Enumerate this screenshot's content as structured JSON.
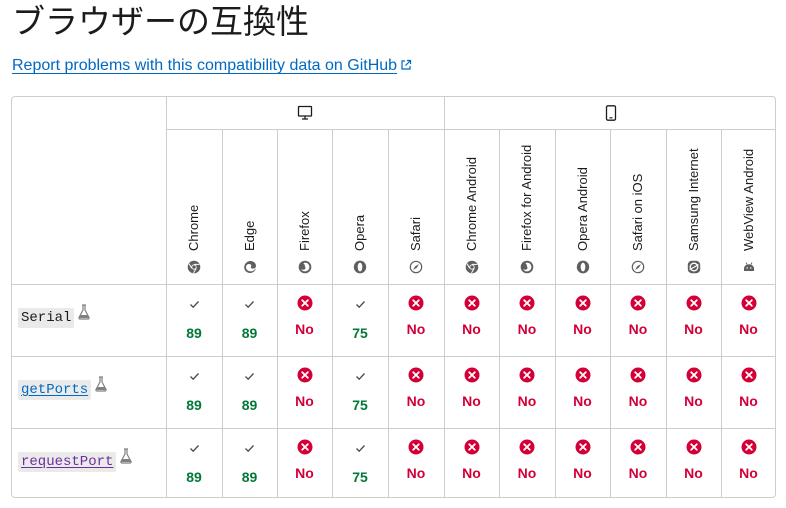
{
  "heading": "ブラウザーの互換性",
  "report_link": "Report problems with this compatibility data on GitHub",
  "groups": [
    {
      "name": "desktop",
      "icon": "desktop-icon"
    },
    {
      "name": "mobile",
      "icon": "mobile-icon"
    }
  ],
  "browsers": [
    {
      "name": "Chrome",
      "icon": "chrome-icon"
    },
    {
      "name": "Edge",
      "icon": "edge-icon"
    },
    {
      "name": "Firefox",
      "icon": "firefox-icon"
    },
    {
      "name": "Opera",
      "icon": "opera-icon"
    },
    {
      "name": "Safari",
      "icon": "safari-icon"
    },
    {
      "name": "Chrome Android",
      "icon": "chrome-icon"
    },
    {
      "name": "Firefox for Android",
      "icon": "firefox-icon"
    },
    {
      "name": "Opera Android",
      "icon": "opera-icon"
    },
    {
      "name": "Safari on iOS",
      "icon": "safari-icon"
    },
    {
      "name": "Samsung Internet",
      "icon": "samsung-internet-icon"
    },
    {
      "name": "WebView Android",
      "icon": "android-icon"
    }
  ],
  "rows": [
    {
      "feature": "Serial",
      "style": "plain",
      "experimental": true,
      "support": [
        "89",
        "89",
        "No",
        "75",
        "No",
        "No",
        "No",
        "No",
        "No",
        "No",
        "No"
      ]
    },
    {
      "feature": "getPorts",
      "style": "link",
      "experimental": true,
      "support": [
        "89",
        "89",
        "No",
        "75",
        "No",
        "No",
        "No",
        "No",
        "No",
        "No",
        "No"
      ]
    },
    {
      "feature": "requestPort",
      "style": "visited",
      "experimental": true,
      "support": [
        "89",
        "89",
        "No",
        "75",
        "No",
        "No",
        "No",
        "No",
        "No",
        "No",
        "No"
      ]
    }
  ],
  "colors": {
    "yes": "#007936",
    "no": "#d30038",
    "link": "#0069c2",
    "border": "#cdcdcd"
  }
}
